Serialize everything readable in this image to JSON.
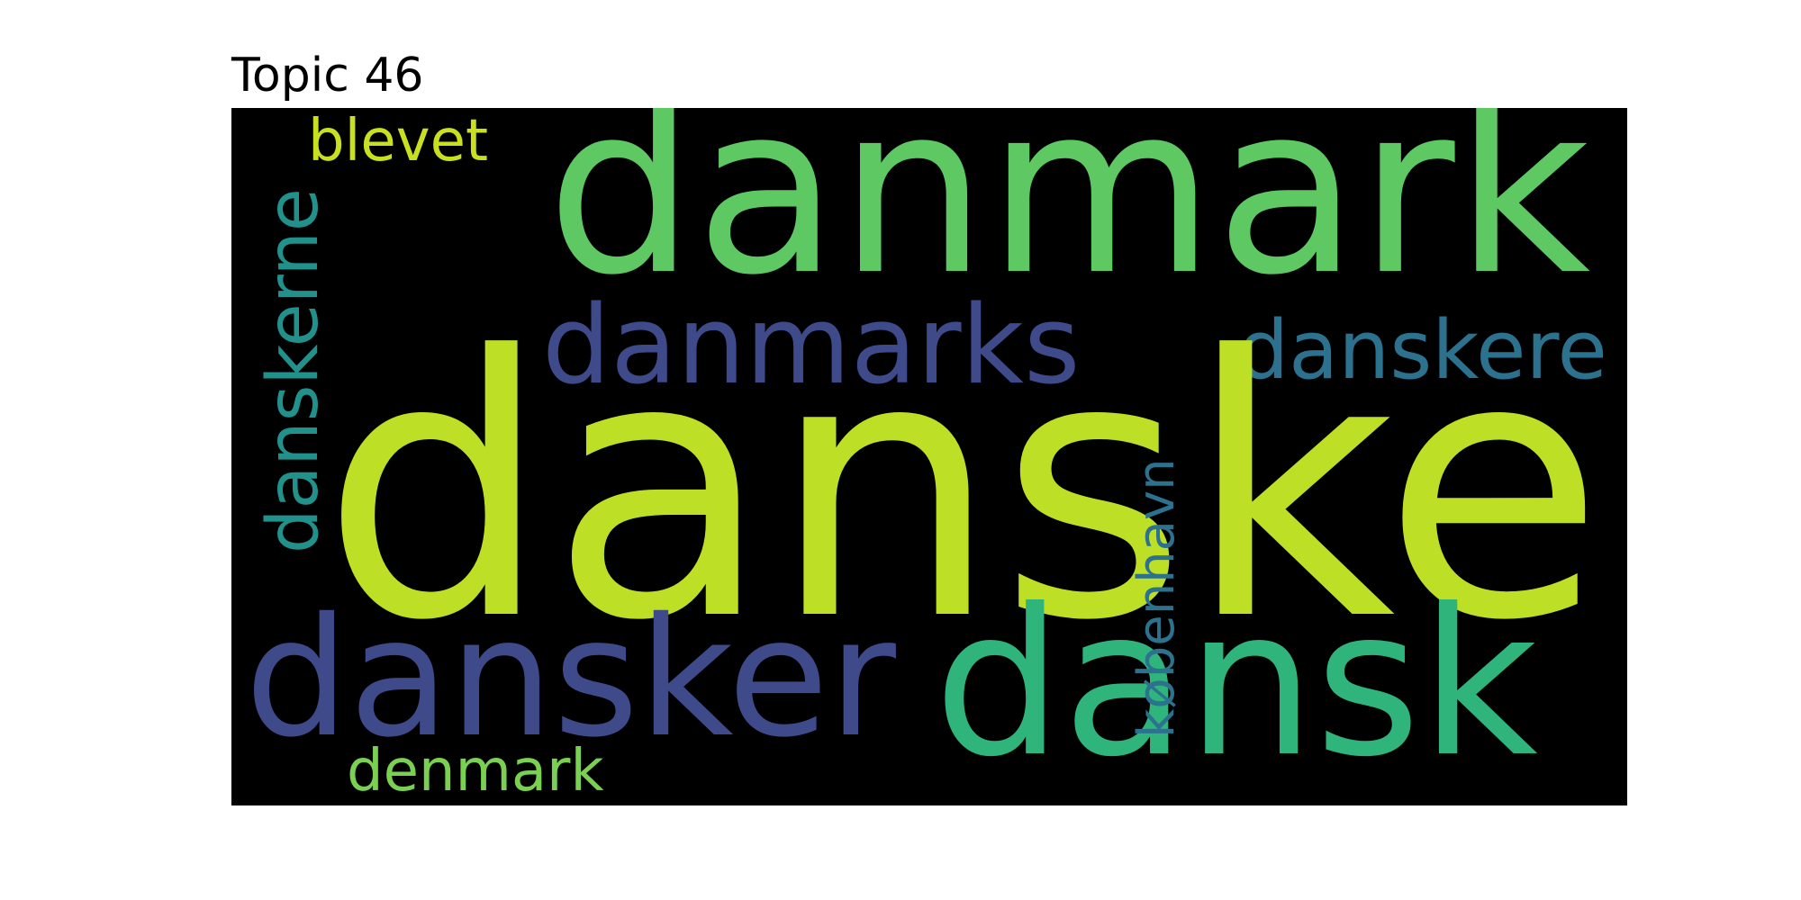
{
  "title": "Topic 46",
  "background_color": "#000000",
  "words": [
    {
      "key": "danske",
      "text": "danske",
      "color": "#bddf26"
    },
    {
      "key": "danmark",
      "text": "danmark",
      "color": "#5ec962"
    },
    {
      "key": "dansk",
      "text": "dansk",
      "color": "#2fb47c"
    },
    {
      "key": "dansker",
      "text": "dansker",
      "color": "#3e4a89"
    },
    {
      "key": "danmarks",
      "text": "danmarks",
      "color": "#3e4a89"
    },
    {
      "key": "danskere",
      "text": "danskere",
      "color": "#2c728e"
    },
    {
      "key": "danskerne",
      "text": "danskerne",
      "color": "#21918c"
    },
    {
      "key": "kobenhavn",
      "text": "københavn",
      "color": "#2c728e"
    },
    {
      "key": "blevet",
      "text": "blevet",
      "color": "#c8e020"
    },
    {
      "key": "denmark",
      "text": "denmark",
      "color": "#7ad151"
    }
  ]
}
